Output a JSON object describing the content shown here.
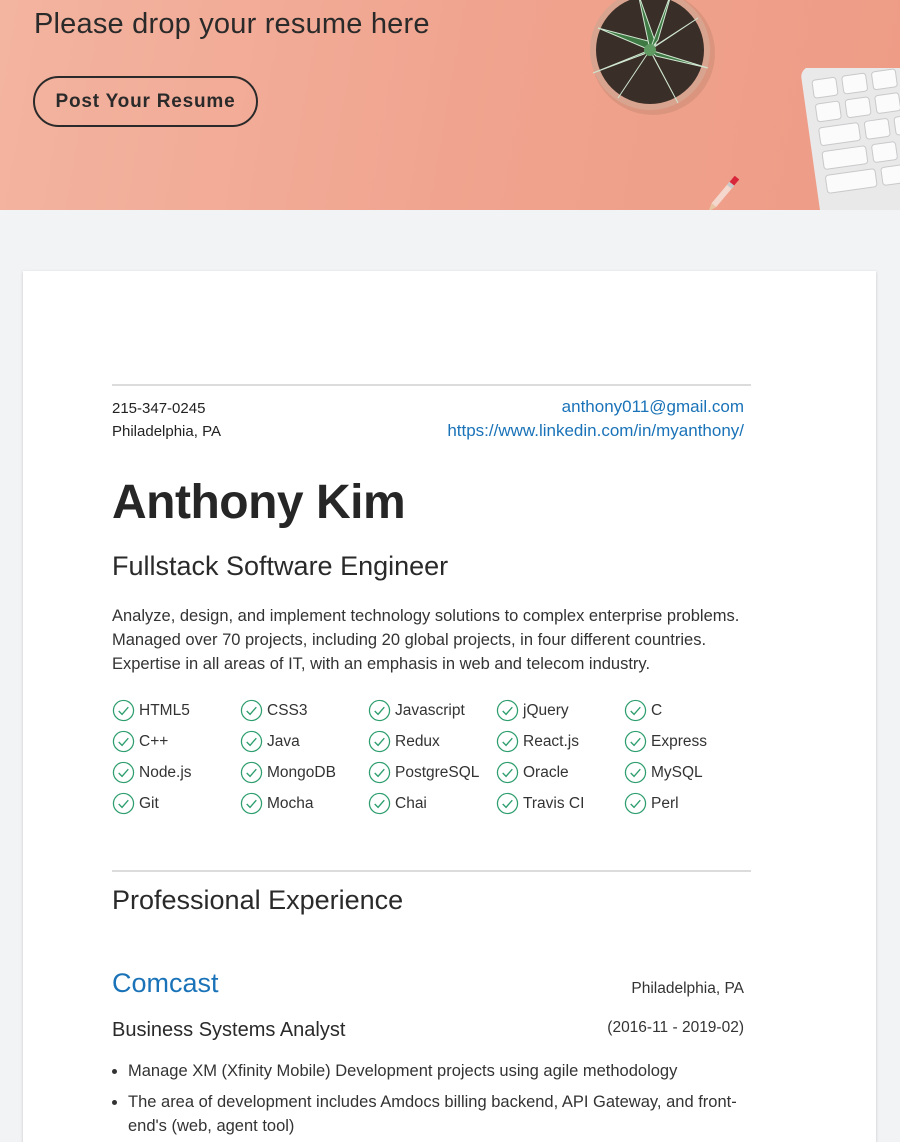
{
  "banner": {
    "title": "Please drop your resume here",
    "button_label": "Post Your Resume",
    "background": "#f0a38e"
  },
  "resume": {
    "phone": "215-347-0245",
    "location": "Philadelphia, PA",
    "email": "anthony011@gmail.com",
    "linkedin": "https://www.linkedin.com/in/myanthony/",
    "name": "Anthony Kim",
    "role": "Fullstack Software Engineer",
    "summary": "Analyze, design, and implement technology solutions to complex enterprise problems. Managed over 70 projects, including 20 global projects, in four different countries. Expertise in all areas of IT, with an emphasis in web and telecom industry.",
    "skills": [
      "HTML5",
      "CSS3",
      "Javascript",
      "jQuery",
      "C",
      "C++",
      "Java",
      "Redux",
      "React.js",
      "Express",
      "Node.js",
      "MongoDB",
      "PostgreSQL",
      "Oracle",
      "MySQL",
      "Git",
      "Mocha",
      "Chai",
      "Travis CI",
      "Perl"
    ],
    "experience_heading": "Professional Experience",
    "experience": [
      {
        "company": "Comcast",
        "location": "Philadelphia, PA",
        "title": "Business Systems Analyst",
        "dates": "(2016-11 - 2019-02)",
        "bullets": [
          "Manage XM (Xfinity Mobile) Development projects using agile methodology",
          "The area of development includes Amdocs billing backend, API Gateway, and front-end's (web, agent tool)"
        ]
      }
    ]
  },
  "colors": {
    "link": "#1a73b8",
    "check": "#2e9e6e",
    "page_bg": "#f2f3f5"
  }
}
